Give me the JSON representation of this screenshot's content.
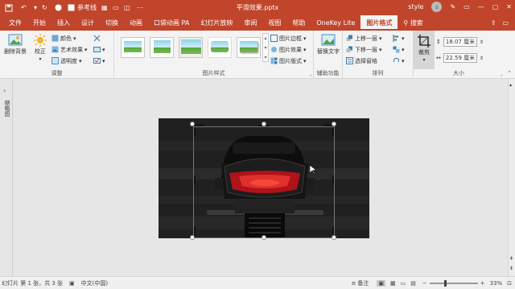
{
  "titlebar": {
    "autosave": "参考线",
    "title": "平滑效果.pptx",
    "user": "style",
    "avatar_letter": "s"
  },
  "tabs": [
    "文件",
    "开始",
    "插入",
    "设计",
    "切换",
    "动画",
    "口袋动画 PA",
    "幻灯片放映",
    "审阅",
    "视图",
    "帮助",
    "OneKey Lite",
    "图片格式",
    "搜索"
  ],
  "ribbon": {
    "remove_bg": "删除背景",
    "correct": "校正",
    "color": "颜色",
    "art_effect": "艺术效果",
    "transparency": "透明度",
    "adjust_group": "调整",
    "style_group": "图片样式",
    "border": "图片边框",
    "effect": "图片效果",
    "layout": "图片版式",
    "alt_text": "替换文字",
    "accessibility_group": "辅助功能",
    "bring_forward": "上移一层",
    "send_backward": "下移一层",
    "selection_pane": "选择窗格",
    "arrange_group": "排列",
    "crop": "裁剪",
    "height": "18.07 厘米",
    "width": "22.59 厘米",
    "size_group": "大小"
  },
  "leftpane": {
    "label": "缩略图"
  },
  "status": {
    "slide_info": "幻灯片 第 1 张，共 3 张",
    "language": "中文(中国)",
    "notes": "备注",
    "zoom": "33%"
  },
  "colors": {
    "accent": "#c0452b",
    "ribbon_bg": "#f3f3f3"
  }
}
